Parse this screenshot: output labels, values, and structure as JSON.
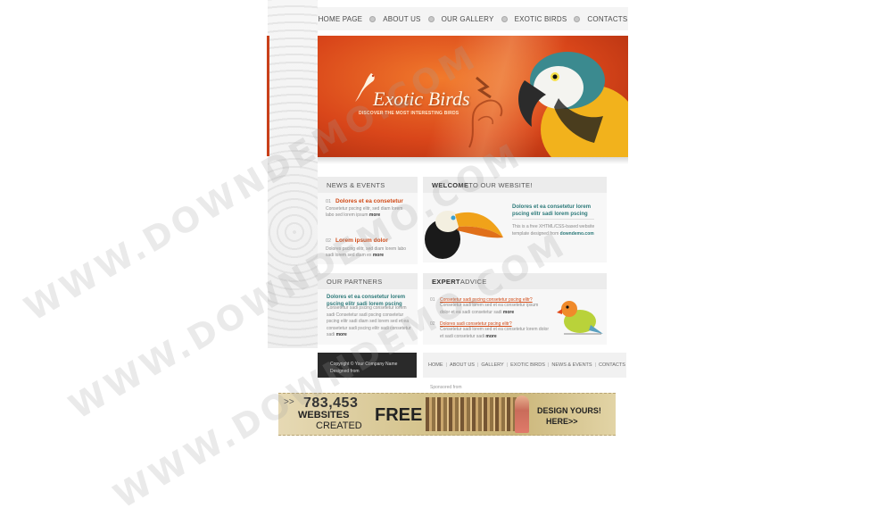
{
  "nav": {
    "items": [
      "HOME PAGE",
      "ABOUT US",
      "OUR GALLERY",
      "EXOTIC BIRDS",
      "CONTACTS"
    ]
  },
  "banner": {
    "title": "Exotic Birds",
    "subtitle": "DISCOVER THE MOST INTERESTING BIRDS"
  },
  "news": {
    "heading": "NEWS & EVENTS",
    "items": [
      {
        "num": "01",
        "title": "Dolores et ea consetetur",
        "text": "Consetetur pscing elitr, sed diam lorem labo sed lorem ipsum",
        "more": "more"
      },
      {
        "num": "02",
        "title": "Lorem ipsum dolor",
        "text": "Dolores pscing elitr, sed diam lorem labo sadi lorem sed diam ex",
        "more": "more"
      }
    ]
  },
  "welcome": {
    "heading_bold": "WELCOME",
    "heading_rest": " TO OUR WEBSITE!",
    "title": "Dolores et ea consetetur lorem pscing elitr sadi lorem pscing",
    "text": "This is a free XHTML/CSS-based website template designed from",
    "link": "downdemo.com"
  },
  "partners": {
    "heading": "OUR PARTNERS",
    "title": "Dolores et ea consetetur lorem pscing elitr sadi lorem pscing",
    "text": "Consetetur sadi pscing consetetur lorem sadi Consetetur sadi pscing consetetur pscing elitr sadi diam sed lorem sed et ea consetetur sadi pscing elitr sadi consetetur sadi",
    "more": "more"
  },
  "expert": {
    "heading_bold": "EXPERT",
    "heading_rest": " ADVICE",
    "items": [
      {
        "num": "01",
        "link": "Consetetur sadi pscing consetetur pscing elitr?",
        "text": "Consetetur sadi lorem sed et ea consetetur ipsum dolor et ea sadi consetetur sadi",
        "more": "more"
      },
      {
        "num": "02",
        "link": "Dolores sadi consetetur pscing elitr?",
        "text": "Consetetur sadi lorem sed et ea consetetur lorem dolor et sadi consetetur sadi",
        "more": "more"
      }
    ]
  },
  "footer": {
    "copyright": "Copyright © Your Company Name",
    "designed": "Designed from",
    "links": [
      "HOME",
      "ABOUT US",
      "GALLERY",
      "EXOTIC BIRDS",
      "NEWS & EVENTS",
      "CONTACTS"
    ]
  },
  "sponsored": "Sponsored from",
  "ad": {
    "number": "783,453",
    "line1": "WEBSITES",
    "line2": "CREATED",
    "free": "FREE",
    "design": "DESIGN YOURS!",
    "here": "HERE>>",
    "arrow": ">>"
  },
  "watermark": "WWW.DOWNDEMO.COM",
  "colors": {
    "accent": "#d14a16",
    "teal": "#2d7a7a",
    "banner": "#e05a20"
  }
}
